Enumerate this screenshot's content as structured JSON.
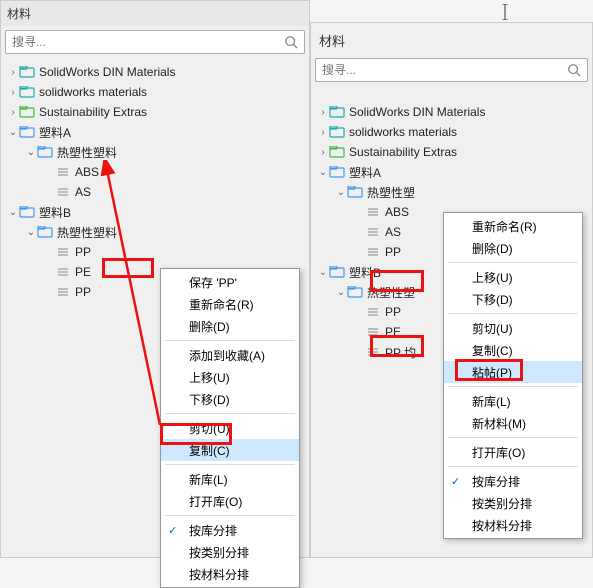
{
  "left": {
    "panel_label": "材料",
    "search_placeholder": "搜寻...",
    "tree": {
      "n0": "SolidWorks DIN Materials",
      "n1": "solidworks materials",
      "n2": "Sustainability Extras",
      "n3": "塑料A",
      "n4": "热塑性塑料",
      "n5": "ABS",
      "n6": "AS",
      "n7": "塑料B",
      "n8": "热塑性塑料",
      "n9": "PP",
      "n10": "PE",
      "n11": "PP"
    },
    "ctx": {
      "m0": "保存 'PP'",
      "m1": "重新命名(R)",
      "m2": "删除(D)",
      "m3": "添加到收藏(A)",
      "m4": "上移(U)",
      "m5": "下移(D)",
      "m6": "剪切(U)",
      "m7": "复制(C)",
      "m8": "新库(L)",
      "m9": "打开库(O)",
      "m10": "按库分排",
      "m11": "按类别分排",
      "m12": "按材料分排"
    }
  },
  "right": {
    "panel_label": "材料",
    "search_placeholder": "搜寻...",
    "tree": {
      "n0": "SolidWorks DIN Materials",
      "n1": "solidworks materials",
      "n2": "Sustainability Extras",
      "n3": "塑料A",
      "n4": "热塑性塑",
      "n5": "ABS",
      "n6": "AS",
      "n7": "PP",
      "n8": "塑料B",
      "n9": "热塑性塑",
      "n10": "PP",
      "n11": "PE",
      "n12": "PP 均"
    },
    "ctx": {
      "m0": "重新命名(R)",
      "m1": "删除(D)",
      "m2": "上移(U)",
      "m3": "下移(D)",
      "m4": "剪切(U)",
      "m5": "复制(C)",
      "m6": "粘帖(P)",
      "m7": "新库(L)",
      "m8": "新材料(M)",
      "m9": "打开库(O)",
      "m10": "按库分排",
      "m11": "按类别分排",
      "m12": "按材料分排"
    }
  },
  "colors": {
    "highlight": "#cde8ff",
    "redbox": "#e11",
    "folder_teal": "#2aa",
    "folder_green": "#4b4",
    "folder_blue": "#49e",
    "leaf": "#888"
  }
}
